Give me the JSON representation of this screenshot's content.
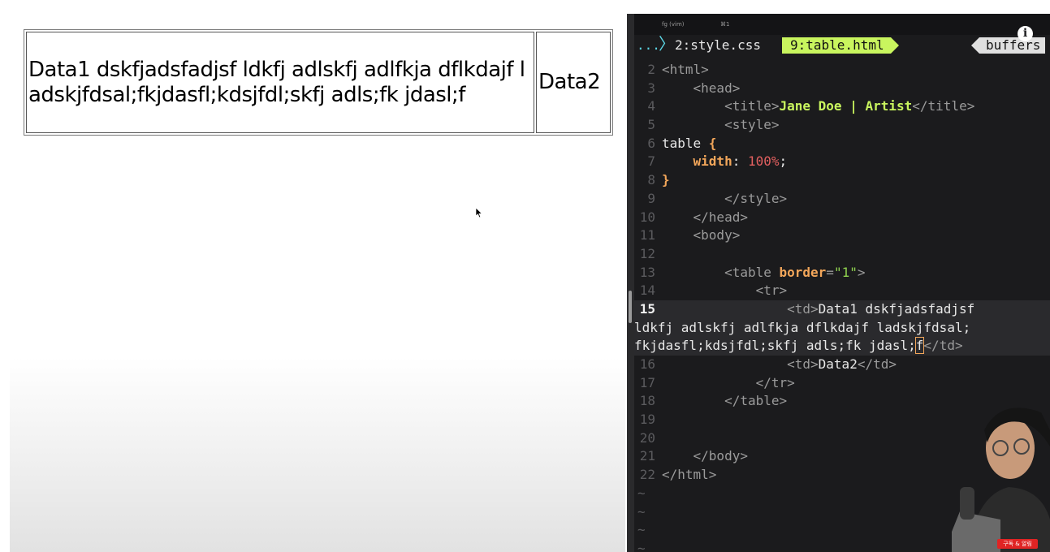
{
  "browser": {
    "table": {
      "cell1": "Data1 dskfjadsfadjsf ldkfj adlskfj adlfkja dflkdajf ladskjfdsal;fkjdasfl;kdsjfdl;skfj adls;fk jdasl;f",
      "cell2": "Data2"
    }
  },
  "terminal": {
    "titlebar": {
      "process": "fg (vim)",
      "shortcut": "⌘1"
    },
    "tabs": {
      "more": "...",
      "style": "2:style.css",
      "table": "9:table.html",
      "buffers": "buffers"
    },
    "code": {
      "l2": {
        "n": "2",
        "open": "<html>"
      },
      "l3": {
        "n": "3",
        "open": "<head>"
      },
      "l4": {
        "n": "4",
        "open": "<title>",
        "text": "Jane Doe | Artist",
        "close": "</title>"
      },
      "l5": {
        "n": "5",
        "open": "<style>"
      },
      "l6": {
        "n": "6",
        "sel": "table ",
        "brace": "{"
      },
      "l7": {
        "n": "7",
        "prop": "width",
        "colon": ": ",
        "val": "100%",
        "semi": ";"
      },
      "l8": {
        "n": "8",
        "brace": "}"
      },
      "l9": {
        "n": "9",
        "close": "</style>"
      },
      "l10": {
        "n": "10",
        "close": "</head>"
      },
      "l11": {
        "n": "11",
        "open": "<body>"
      },
      "l12": {
        "n": "12"
      },
      "l13": {
        "n": "13",
        "open": "<table ",
        "attr": "border",
        "eq": "=",
        "str": "\"1\"",
        "end": ">"
      },
      "l14": {
        "n": "14",
        "open": "<tr>"
      },
      "l15": {
        "n": "15",
        "open": "<td>",
        "a": "Data1 dskfjadsfadjsf",
        "b": "ldkfj adlskfj adlfkja dflkdajf ladskjfdsal;",
        "c": "fkjdasfl;kdsjfdl;skfj adls;fk jdasl;",
        "cur": "f",
        "close": "</td>"
      },
      "l16": {
        "n": "16",
        "open": "<td>",
        "text": "Data2",
        "close": "</td>"
      },
      "l17": {
        "n": "17",
        "close": "</tr>"
      },
      "l18": {
        "n": "18",
        "close": "</table>"
      },
      "l19": {
        "n": "19"
      },
      "l20": {
        "n": "20"
      },
      "l21": {
        "n": "21",
        "close": "</body>"
      },
      "l22": {
        "n": "22",
        "close": "</html>"
      },
      "tilde": "~"
    },
    "badge": "구독 & 알림"
  },
  "colors": {
    "terminal_bg": "#1b1b1d",
    "tab_active": "#c9f55e",
    "accent_cyan": "#5cd7e6",
    "keyword_orange": "#f2a65a",
    "string_green": "#8fd14f",
    "number_red": "#e46060"
  },
  "icons": [
    "info-icon",
    "mouse-pointer-icon",
    "chevron-right-icon"
  ]
}
